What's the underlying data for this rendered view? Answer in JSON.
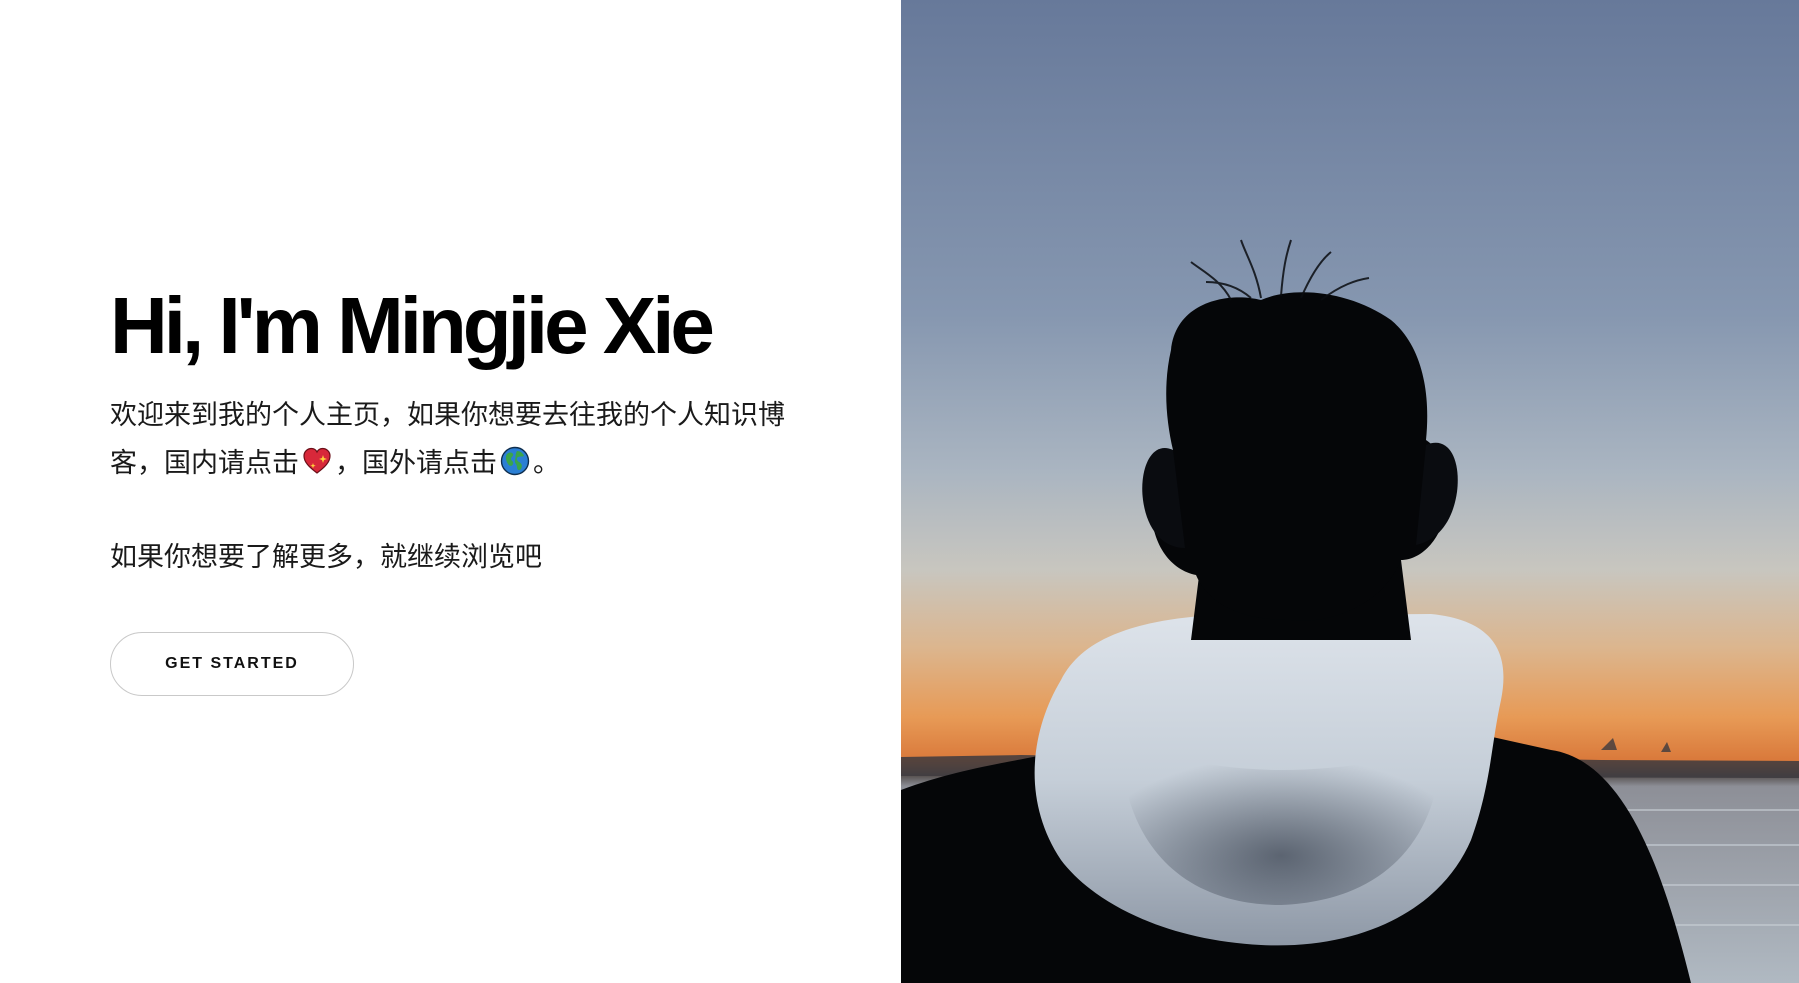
{
  "hero": {
    "title": "Hi, I'm Mingjie Xie",
    "para1_part1": "欢迎来到我的个人主页，如果你想要去往我的个人知识博客，国内请点击",
    "para1_part2": "，国外请点击",
    "para1_part3": "。",
    "para2": "如果你想要了解更多，就继续浏览吧",
    "cta_label": "GET STARTED",
    "domestic_link_icon": "sparkling-heart-icon",
    "international_link_icon": "globe-icon"
  },
  "photo": {
    "icon": "person-silhouette-sunset-photo",
    "colors": {
      "sky_top": "#6b7f9c",
      "sky_mid": "#aeb9c3",
      "horizon": "#e49a55",
      "water": "#a5b0b9",
      "silhouette": "#050608",
      "hood": "#d6dde4"
    }
  }
}
